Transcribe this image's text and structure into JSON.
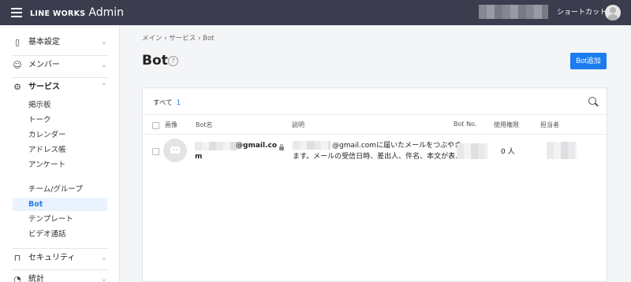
{
  "app": {
    "brand": "LINE WORKS",
    "suffix": "Admin",
    "shortcut_label": "ショートカット"
  },
  "sidebar": {
    "sections": [
      {
        "label": "基本設定",
        "icon": "building-icon",
        "chevron": "⌄"
      },
      {
        "label": "メンバー",
        "icon": "person-icon",
        "chevron": "⌄"
      },
      {
        "label": "サービス",
        "icon": "gear-icon",
        "chevron": "⌃"
      },
      {
        "label": "セキュリティ",
        "icon": "lock-icon",
        "chevron": "⌄"
      },
      {
        "label": "統計",
        "icon": "chart-icon",
        "chevron": "⌄"
      }
    ],
    "service_items": [
      {
        "label": "掲示板"
      },
      {
        "label": "トーク"
      },
      {
        "label": "カレンダー"
      },
      {
        "label": "アドレス帳"
      },
      {
        "label": "アンケート"
      },
      {
        "label": "チーム/グループ"
      },
      {
        "label": "Bot"
      },
      {
        "label": "テンプレート"
      },
      {
        "label": "ビデオ通話"
      }
    ],
    "active_item": "Bot"
  },
  "breadcrumb": "メイン  ›  サービス  ›  Bot",
  "page": {
    "title": "Bot",
    "add_button": "Bot追加",
    "help": "?"
  },
  "filter": {
    "all_label": "すべて",
    "count": "1"
  },
  "table": {
    "headers": [
      "画像",
      "Bot名",
      "説明",
      "Bot No.",
      "使用権限",
      "担当者"
    ],
    "rows": [
      {
        "name_part1": "@gmail.co",
        "name_part2": "m",
        "desc_line1": "@gmail.comに届いたメールをつぶやき",
        "desc_line2": "ます。メールの受信日時、差出人、件名、本文が表…",
        "usage": "0 人"
      }
    ]
  },
  "colors": {
    "topbar": "#3b3c4d",
    "accent": "#1c7cf0",
    "active_bg": "#eaf3fd"
  }
}
